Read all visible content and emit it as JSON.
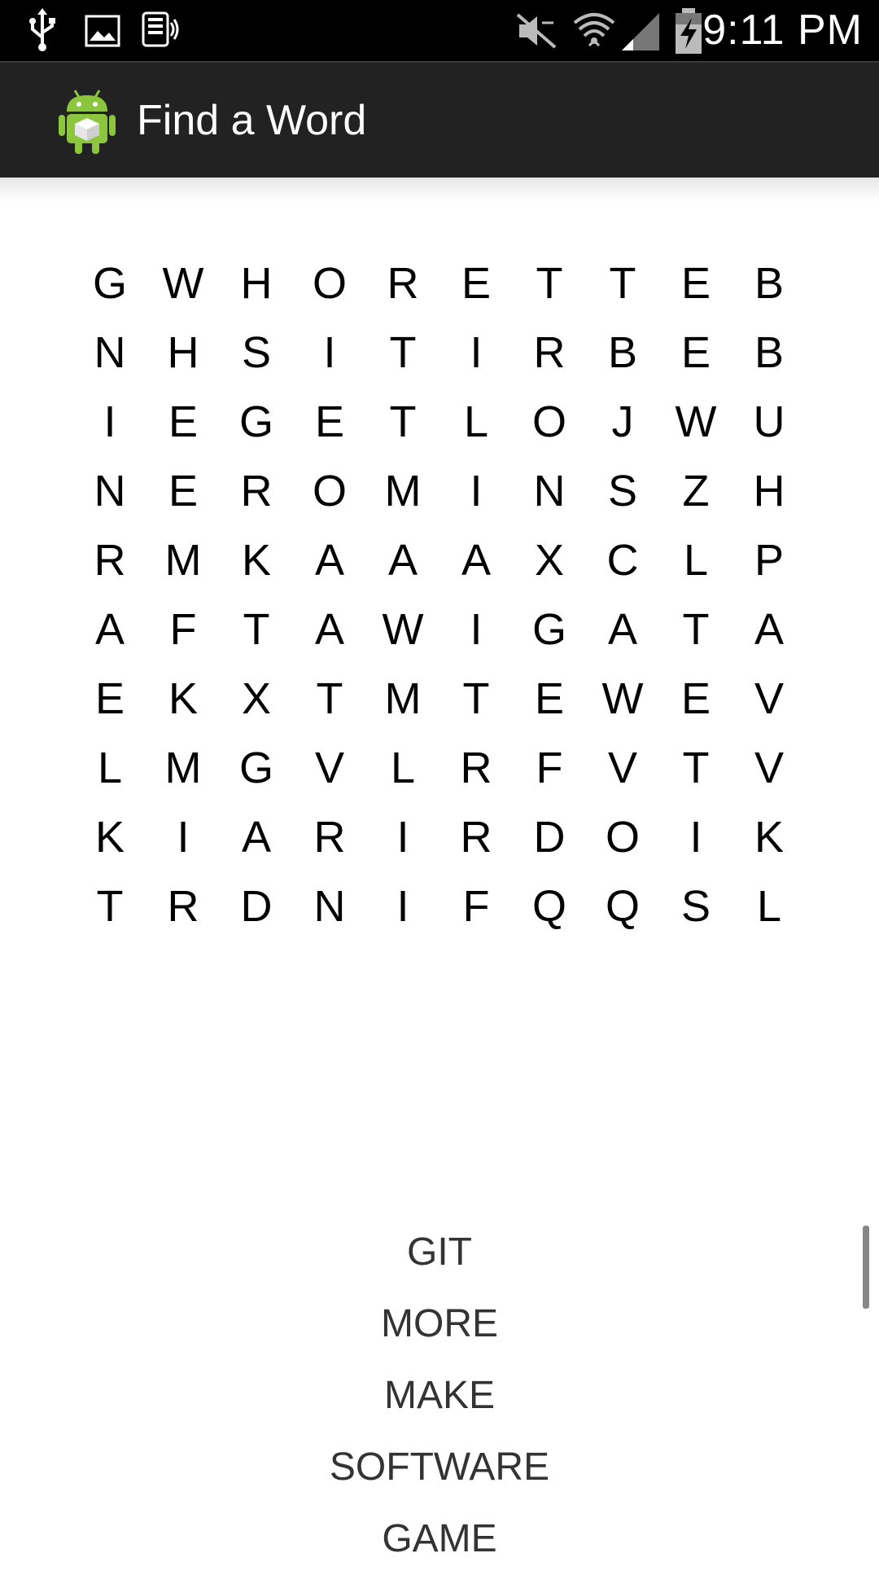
{
  "status_bar": {
    "time": "9:11 PM",
    "icons": [
      "usb-icon",
      "gallery-icon",
      "voicemail-icon",
      "mute-icon",
      "wifi-icon",
      "signal-icon",
      "battery-charging-icon"
    ]
  },
  "action_bar": {
    "title": "Find a Word",
    "icon": "android-icon"
  },
  "grid": [
    [
      "G",
      "W",
      "H",
      "O",
      "R",
      "E",
      "T",
      "T",
      "E",
      "B"
    ],
    [
      "N",
      "H",
      "S",
      "I",
      "T",
      "I",
      "R",
      "B",
      "E",
      "B"
    ],
    [
      "I",
      "E",
      "G",
      "E",
      "T",
      "L",
      "O",
      "J",
      "W",
      "U"
    ],
    [
      "N",
      "E",
      "R",
      "O",
      "M",
      "I",
      "N",
      "S",
      "Z",
      "H"
    ],
    [
      "R",
      "M",
      "K",
      "A",
      "A",
      "A",
      "X",
      "C",
      "L",
      "P"
    ],
    [
      "A",
      "F",
      "T",
      "A",
      "W",
      "I",
      "G",
      "A",
      "T",
      "A"
    ],
    [
      "E",
      "K",
      "X",
      "T",
      "M",
      "T",
      "E",
      "W",
      "E",
      "V"
    ],
    [
      "L",
      "M",
      "G",
      "V",
      "L",
      "R",
      "F",
      "V",
      "T",
      "V"
    ],
    [
      "K",
      "I",
      "A",
      "R",
      "I",
      "R",
      "D",
      "O",
      "I",
      "K"
    ],
    [
      "T",
      "R",
      "D",
      "N",
      "I",
      "F",
      "Q",
      "Q",
      "S",
      "L"
    ]
  ],
  "words": [
    "GIT",
    "MORE",
    "MAKE",
    "SOFTWARE",
    "GAME"
  ]
}
